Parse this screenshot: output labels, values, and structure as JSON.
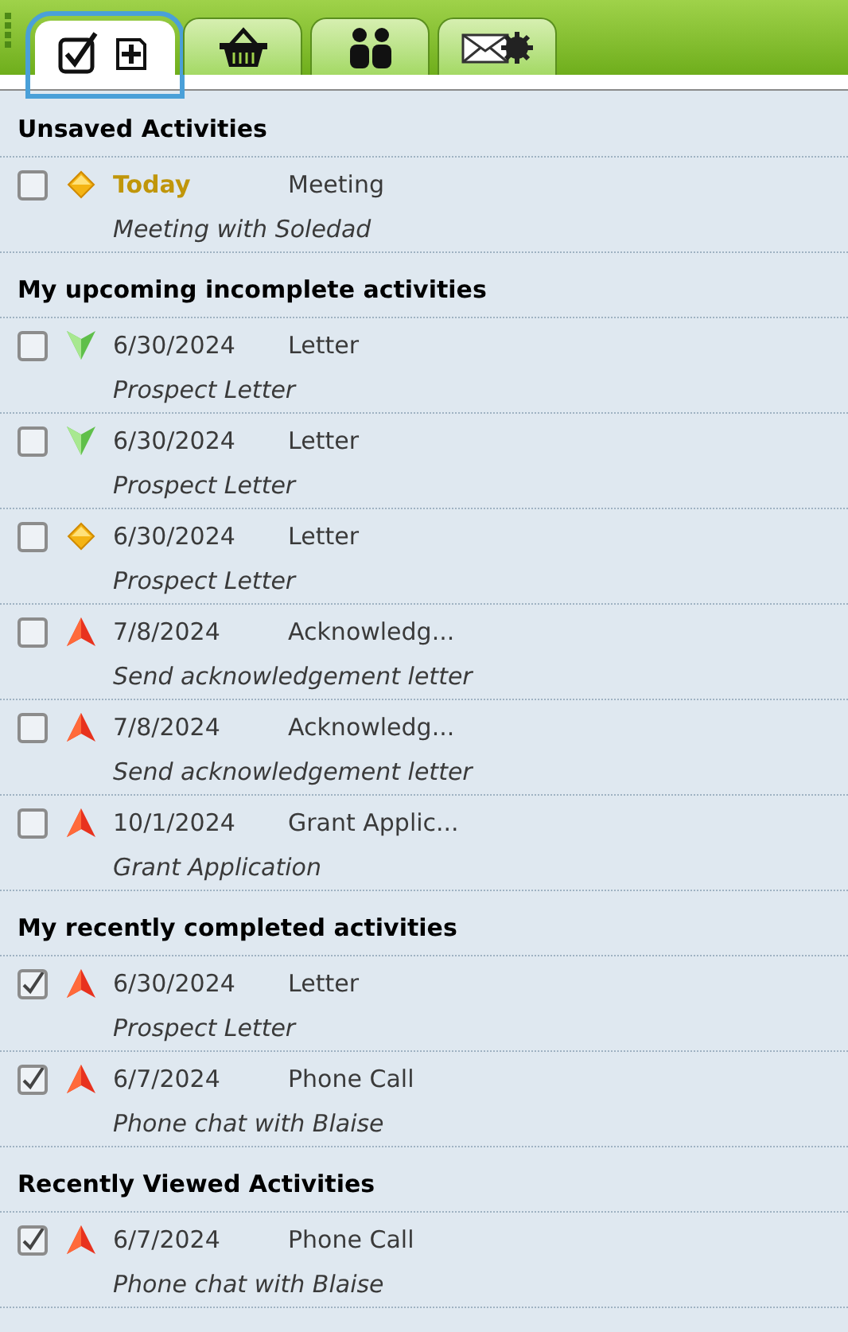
{
  "tabs": [
    {
      "kind": "activities",
      "selected": true
    },
    {
      "kind": "basket",
      "selected": false
    },
    {
      "kind": "people",
      "selected": false
    },
    {
      "kind": "mail",
      "selected": false
    }
  ],
  "sections": [
    {
      "title": "Unsaved Activities",
      "rows": [
        {
          "checked": false,
          "kind": "normal",
          "date": "Today",
          "today": true,
          "type": "Meeting",
          "subject": "Meeting with Soledad"
        }
      ]
    },
    {
      "title": "My upcoming incomplete activities",
      "rows": [
        {
          "checked": false,
          "kind": "low",
          "date": "6/30/2024",
          "today": false,
          "type": "Letter",
          "subject": "Prospect Letter"
        },
        {
          "checked": false,
          "kind": "low",
          "date": "6/30/2024",
          "today": false,
          "type": "Letter",
          "subject": "Prospect Letter"
        },
        {
          "checked": false,
          "kind": "normal",
          "date": "6/30/2024",
          "today": false,
          "type": "Letter",
          "subject": "Prospect Letter"
        },
        {
          "checked": false,
          "kind": "high",
          "date": "7/8/2024",
          "today": false,
          "type": "Acknowledg...",
          "subject": "Send acknowledgement letter"
        },
        {
          "checked": false,
          "kind": "high",
          "date": "7/8/2024",
          "today": false,
          "type": "Acknowledg...",
          "subject": "Send acknowledgement letter"
        },
        {
          "checked": false,
          "kind": "high",
          "date": "10/1/2024",
          "today": false,
          "type": "Grant Applic...",
          "subject": "Grant Application"
        }
      ]
    },
    {
      "title": "My recently completed activities",
      "rows": [
        {
          "checked": true,
          "kind": "high",
          "date": "6/30/2024",
          "today": false,
          "type": "Letter",
          "subject": "Prospect Letter"
        },
        {
          "checked": true,
          "kind": "high",
          "date": "6/7/2024",
          "today": false,
          "type": "Phone Call",
          "subject": "Phone chat with Blaise"
        }
      ]
    },
    {
      "title": "Recently Viewed Activities",
      "rows": [
        {
          "checked": true,
          "kind": "high",
          "date": "6/7/2024",
          "today": false,
          "type": "Phone Call",
          "subject": "Phone chat with Blaise"
        }
      ]
    }
  ]
}
